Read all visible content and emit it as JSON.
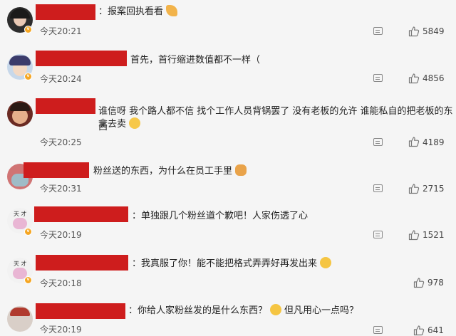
{
  "comments": [
    {
      "text": "：报案回执看看",
      "time": "今天20:21",
      "likes": "5849"
    },
    {
      "text": "首先，首行缩进数值都不一样（",
      "time": "今天20:24",
      "likes": "4856"
    },
    {
      "text_line1": "谁信呀 我个路人都不信 找个工作人员背锅罢了 没有老板的允许 谁能私自的把老板的东西",
      "text_line2": "拿去卖",
      "time": "今天20:25",
      "likes": "4189"
    },
    {
      "text": "粉丝送的东西，为什么在员工手里",
      "time": "今天20:31",
      "likes": "2715"
    },
    {
      "text": "：单独跟几个粉丝道个歉吧！人家伤透了心",
      "time": "今天20:19",
      "likes": "1521"
    },
    {
      "text": "：我真服了你！能不能把格式弄弄好再发出来",
      "time": "今天20:18",
      "likes": "978"
    },
    {
      "text1": "：你给人家粉丝发的是什么东西？",
      "text2": "但凡用心一点吗？",
      "time": "今天20:19",
      "likes": "641"
    }
  ],
  "icons": {
    "reply": "comment-reply-icon",
    "like": "thumbs-up-icon",
    "badge": "verified-badge-icon"
  },
  "colors": {
    "redaction": "#ce1d1d",
    "badge": "#f5a623",
    "background": "#f5f5f5"
  }
}
